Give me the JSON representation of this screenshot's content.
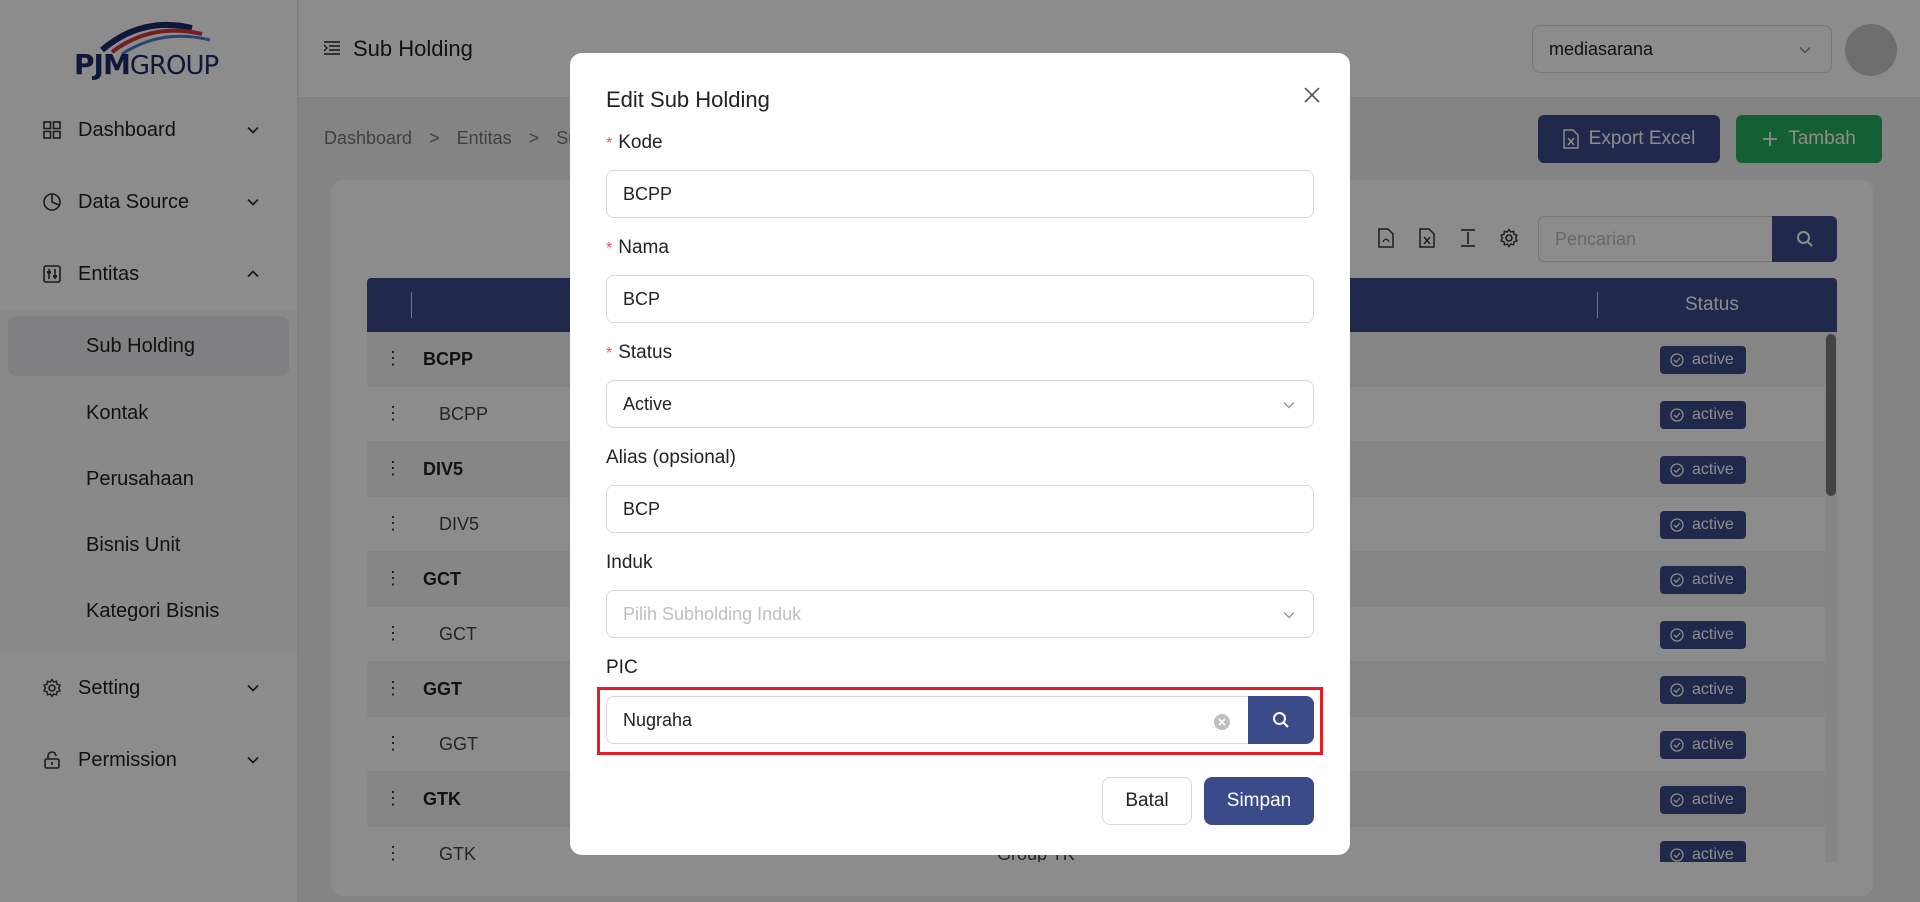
{
  "brand": {
    "logo_main": "PJM",
    "logo_sub": "GROUP"
  },
  "sidebar": {
    "items": [
      {
        "label": "Dashboard",
        "icon": "grid-icon"
      },
      {
        "label": "Data Source",
        "icon": "pie-chart-icon"
      },
      {
        "label": "Entitas",
        "icon": "sliders-icon"
      },
      {
        "label": "Setting",
        "icon": "gear-icon"
      },
      {
        "label": "Permission",
        "icon": "lock-icon"
      }
    ],
    "entitas_sub": [
      "Sub Holding",
      "Kontak",
      "Perusahaan",
      "Bisnis Unit",
      "Kategori Bisnis"
    ]
  },
  "header": {
    "title": "Sub Holding",
    "company": "mediasarana"
  },
  "breadcrumb": [
    "Dashboard",
    ">",
    "Entitas",
    ">",
    "Su"
  ],
  "actions": {
    "export_label": "Export Excel",
    "add_label": "Tambah"
  },
  "search": {
    "placeholder": "Pencarian"
  },
  "table": {
    "status_header": "Status",
    "rows": [
      {
        "code": "BCPP",
        "level": "parent",
        "desc": "",
        "status": "active"
      },
      {
        "code": "BCPP",
        "level": "child",
        "desc": "",
        "status": "active"
      },
      {
        "code": "DIV5",
        "level": "parent",
        "desc": "",
        "status": "active"
      },
      {
        "code": "DIV5",
        "level": "child",
        "desc": "",
        "status": "active"
      },
      {
        "code": "GCT",
        "level": "parent",
        "desc": "",
        "status": "active"
      },
      {
        "code": "GCT",
        "level": "child",
        "desc": "",
        "status": "active"
      },
      {
        "code": "GGT",
        "level": "parent",
        "desc": "",
        "status": "active"
      },
      {
        "code": "GGT",
        "level": "child",
        "desc": "",
        "status": "active"
      },
      {
        "code": "GTK",
        "level": "parent",
        "desc": "",
        "status": "active"
      },
      {
        "code": "GTK",
        "level": "child",
        "desc": "Group TK",
        "status": "active"
      }
    ]
  },
  "modal": {
    "title": "Edit Sub Holding",
    "required_mark": "*",
    "kode_label": "Kode",
    "kode_value": "BCPP",
    "nama_label": "Nama",
    "nama_value": "BCP",
    "status_label": "Status",
    "status_value": "Active",
    "alias_label": "Alias (opsional)",
    "alias_value": "BCP",
    "induk_label": "Induk",
    "induk_placeholder": "Pilih Subholding Induk",
    "pic_label": "PIC",
    "pic_value": "Nugraha",
    "cancel_label": "Batal",
    "save_label": "Simpan"
  },
  "colors": {
    "primary": "#3b4b8a",
    "success": "#27ae60",
    "highlight": "#e31e24",
    "required": "#ff4d4f"
  }
}
